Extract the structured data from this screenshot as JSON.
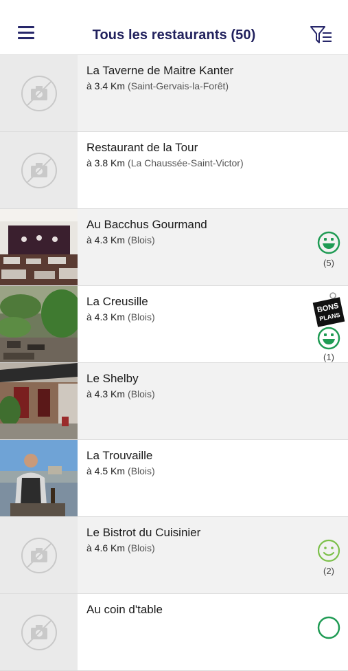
{
  "header": {
    "title": "Tous les restaurants (50)",
    "menu_icon": "hamburger-menu-icon",
    "filter_icon": "filter-list-icon",
    "accent_color": "#22225e"
  },
  "badge": {
    "line1": "BONS",
    "line2": "PLANS"
  },
  "restaurants": [
    {
      "name": "La Taverne de Maitre Kanter",
      "distance": "à 3.4 Km",
      "city": "(Saint-Gervais-la-Forêt)",
      "image": "no-photo"
    },
    {
      "name": "Restaurant de la Tour",
      "distance": "à 3.8 Km",
      "city": "(La Chaussée-Saint-Victor)",
      "image": "no-photo"
    },
    {
      "name": "Au Bacchus Gourmand",
      "distance": "à 4.3 Km",
      "city": "(Blois)",
      "image": "dining-room-photo",
      "rating_count": "(5)"
    },
    {
      "name": "La Creusille",
      "distance": "à 4.3 Km",
      "city": "(Blois)",
      "image": "terrace-photo",
      "rating_count": "(1)",
      "bons_plans": true
    },
    {
      "name": "Le Shelby",
      "distance": "à 4.3 Km",
      "city": "(Blois)",
      "image": "storefront-photo"
    },
    {
      "name": "La Trouvaille",
      "distance": "à 4.5 Km",
      "city": "(Blois)",
      "image": "chef-photo"
    },
    {
      "name": "Le Bistrot du Cuisinier",
      "distance": "à 4.6 Km",
      "city": "(Blois)",
      "image": "no-photo",
      "rating_count": "(2)"
    },
    {
      "name": "Au coin d'table",
      "distance": "",
      "city": "",
      "image": "no-photo"
    }
  ],
  "colors": {
    "smiley_dark": "#1f9b54",
    "smiley_light": "#7cc04a",
    "placeholder_icon": "#c9c9c9"
  }
}
